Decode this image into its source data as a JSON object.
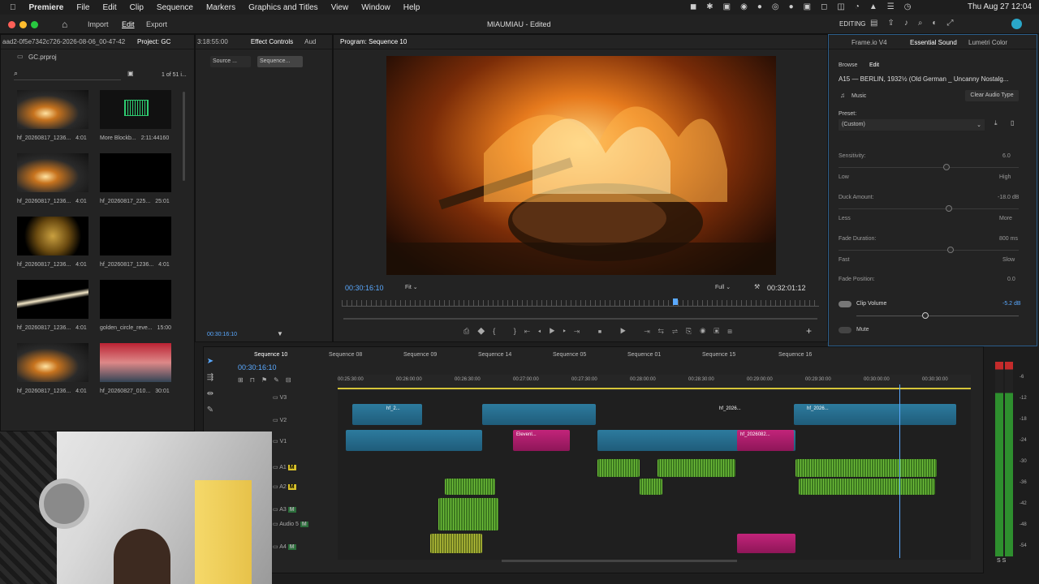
{
  "menubar": {
    "app": "Premiere",
    "items": [
      "File",
      "Edit",
      "Clip",
      "Sequence",
      "Markers",
      "Graphics and Titles",
      "View",
      "Window",
      "Help"
    ],
    "clock": "Thu Aug 27  12:04"
  },
  "titlebar": {
    "nav": [
      "Import",
      "Edit",
      "Export"
    ],
    "title": "MIAUMIAU - Edited",
    "workspace": "EDITING"
  },
  "project": {
    "path": "aad2-0f5e7342c726-2026-08-06_00-47-42",
    "tab": "Project: GC",
    "file": "GC.prproj",
    "count": "1 of 51 i...",
    "items": [
      {
        "name": "hf_20260817_1236...",
        "dur": "4:01",
        "kind": "fire"
      },
      {
        "name": "More Blockb...",
        "dur": "2:11:44160",
        "kind": "audio"
      },
      {
        "name": "hf_20260817_1236...",
        "dur": "4:01",
        "kind": "fire"
      },
      {
        "name": "hf_20260817_225...",
        "dur": "25:01",
        "kind": "black"
      },
      {
        "name": "hf_20260817_1236...",
        "dur": "4:01",
        "kind": "gold"
      },
      {
        "name": "hf_20260817_1236...",
        "dur": "4:01",
        "kind": "black"
      },
      {
        "name": "hf_20260817_1236...",
        "dur": "4:01",
        "kind": "streak"
      },
      {
        "name": "golden_circle_reve...",
        "dur": "15:00",
        "kind": "black"
      },
      {
        "name": "hf_20260817_1236...",
        "dur": "4:01",
        "kind": "fire"
      },
      {
        "name": "hf_20260827_010...",
        "dur": "30:01",
        "kind": "person"
      }
    ]
  },
  "source": {
    "time": "3:18:55:00",
    "tabs": [
      "Effect Controls",
      "Aud"
    ],
    "subtabs": [
      "Source ...",
      "Sequence..."
    ],
    "timecode": "00:30:16:10"
  },
  "program": {
    "title": "Program: Sequence 10",
    "timecode": "00:30:16:10",
    "fit": "Fit",
    "quality": "Full",
    "duration": "00:32:01:12"
  },
  "essential": {
    "tabs": [
      "Frame.io V4",
      "Essential Sound",
      "Lumetri Color"
    ],
    "subtabs": [
      "Browse",
      "Edit"
    ],
    "clip": "A15 — BERLIN, 1932½ (Old German _ Uncanny Nostalg...",
    "type": "Music",
    "clear": "Clear Audio Type",
    "preset_label": "Preset:",
    "preset": "(Custom)",
    "sensitivity": {
      "label": "Sensitivity:",
      "value": "6.0",
      "low": "Low",
      "high": "High"
    },
    "duck": {
      "label": "Duck Amount:",
      "value": "-18.0 dB",
      "low": "Less",
      "high": "More"
    },
    "fade": {
      "label": "Fade Duration:",
      "value": "800 ms",
      "low": "Fast",
      "high": "Slow"
    },
    "fadepos": {
      "label": "Fade Position:",
      "value": "0.0"
    },
    "clipvol": {
      "label": "Clip Volume",
      "value": "-5.2 dB"
    },
    "mute": "Mute"
  },
  "timeline": {
    "tabs": [
      "Sequence 10",
      "Sequence 08",
      "Sequence 09",
      "Sequence 14",
      "Sequence 05",
      "Sequence 01",
      "Sequence 15",
      "Sequence 16"
    ],
    "timecode": "00:30:16:10",
    "ruler": [
      "00:25:30:00",
      "00:26:00:00",
      "00:26:30:00",
      "00:27:00:00",
      "00:27:30:00",
      "00:28:00:00",
      "00:28:30:00",
      "00:29:00:00",
      "00:29:30:00",
      "00:30:00:00",
      "00:30:30:00"
    ],
    "tracks": [
      "V3",
      "V2",
      "V1",
      "A1",
      "A2",
      "A3",
      "Audio 5",
      "A4"
    ],
    "cliplabels": [
      "hf_2...",
      "hf_2026...",
      "hf_2026082...",
      "Elevenl...",
      "hf_2026082...",
      "hf_2026..."
    ],
    "meter": [
      "-6",
      "-12",
      "-18",
      "-24",
      "-30",
      "-36",
      "-42",
      "-48",
      "-54"
    ],
    "meter_footer": "S  S"
  }
}
